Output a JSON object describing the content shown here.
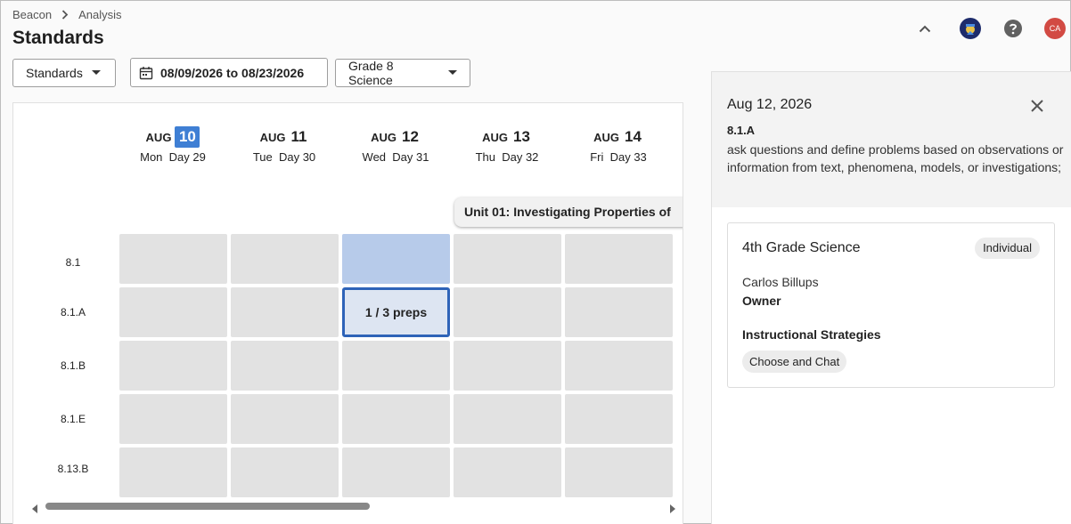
{
  "breadcrumb": {
    "items": [
      "Beacon",
      "Analysis"
    ]
  },
  "page": {
    "title": "Standards"
  },
  "header_icons": {
    "collapse": "chevron-up-icon",
    "brand": "graduate-icon",
    "help": "help-icon",
    "avatar": {
      "initials": "CA",
      "color": "#d24a43"
    }
  },
  "toolbar": {
    "standards_label": "Standards",
    "date_range": "08/09/2026 to 08/23/2026",
    "grade_label": "Grade 8 Science"
  },
  "calendar": {
    "days": [
      {
        "month": "AUG",
        "num": "10",
        "weekday": "Mon",
        "day": "Day 29",
        "today": true
      },
      {
        "month": "AUG",
        "num": "11",
        "weekday": "Tue",
        "day": "Day 30",
        "today": false
      },
      {
        "month": "AUG",
        "num": "12",
        "weekday": "Wed",
        "day": "Day 31",
        "today": false
      },
      {
        "month": "AUG",
        "num": "13",
        "weekday": "Thu",
        "day": "Day 32",
        "today": false
      },
      {
        "month": "AUG",
        "num": "14",
        "weekday": "Fri",
        "day": "Day 33",
        "today": false
      }
    ],
    "unit_label": "Unit 01: Investigating Properties of",
    "standards": [
      "8.1",
      "8.1.A",
      "8.1.B",
      "8.1.E",
      "8.13.B"
    ],
    "selected_cell_text": "1 / 3 preps",
    "colors": {
      "today": "#3f7fd4",
      "highlight": "#b7cbea",
      "selected_border": "#2e63b8",
      "cell": "#e2e2e2"
    }
  },
  "panel": {
    "date": "Aug 12, 2026",
    "code": "8.1.A",
    "description": "ask questions and define problems based on observations or information from text, phenomena, models, or investigations;",
    "card": {
      "title": "4th Grade Science",
      "badge": "Individual",
      "owner_name": "Carlos Billups",
      "owner_role": "Owner",
      "strategies_label": "Instructional Strategies",
      "strategy_chip": "Choose and Chat"
    }
  }
}
